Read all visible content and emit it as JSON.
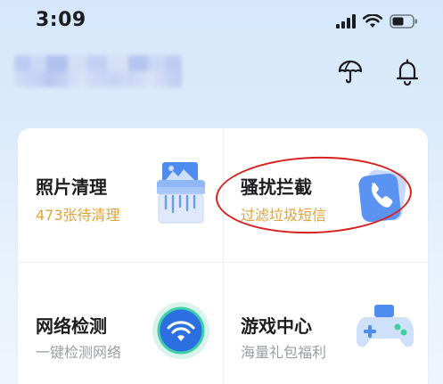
{
  "status_bar": {
    "time": "3:09",
    "icons": [
      "cellular-signal-icon",
      "wifi-icon",
      "battery-icon"
    ]
  },
  "header": {
    "icons": [
      "umbrella-icon",
      "bell-icon"
    ]
  },
  "tiles": [
    {
      "title": "照片清理",
      "subtitle": "473张待清理",
      "icon": "shredder-icon",
      "subtitle_color": "#e2a33a"
    },
    {
      "title": "骚扰拦截",
      "subtitle": "过滤垃圾短信",
      "icon": "phone-icon",
      "subtitle_color": "#e2a33a"
    },
    {
      "title": "网络检测",
      "subtitle": "一键检测网络",
      "icon": "wifi-globe-icon",
      "subtitle_color": "#9a9da3"
    },
    {
      "title": "游戏中心",
      "subtitle": "海量礼包福利",
      "icon": "gamepad-icon",
      "subtitle_color": "#9a9da3"
    }
  ],
  "colors": {
    "accent_orange": "#e2a33a",
    "annotation_red": "#d8221f",
    "icon_blue": "#3b78e7"
  }
}
